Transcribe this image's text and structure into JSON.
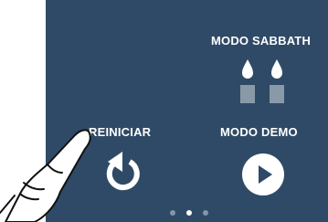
{
  "screen": {
    "background_color": "#2f4a66",
    "accent_color": "#ffffff",
    "candle_body_color": "#8a99a8"
  },
  "sabbath": {
    "label": "MODO SABBATH",
    "icon": "candles-icon"
  },
  "reiniciar": {
    "label": "REINICIAR",
    "icon": "restart-icon"
  },
  "demo": {
    "label": "MODO DEMO",
    "icon": "play-icon"
  },
  "pagination": {
    "total": 3,
    "active_index": 2
  }
}
